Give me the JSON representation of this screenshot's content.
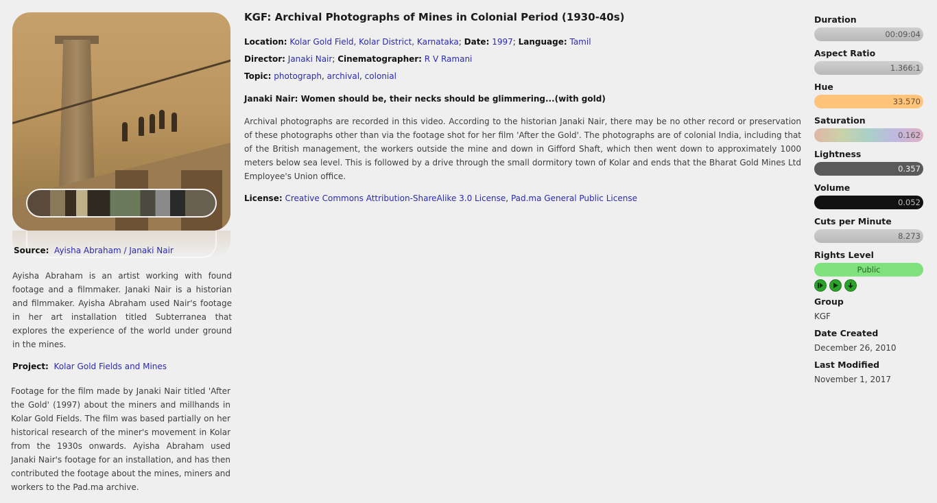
{
  "title": "KGF: Archival Photographs of Mines in Colonial Period (1930-40s)",
  "meta": {
    "location_label": "Location:",
    "location": "Kolar Gold Field, Kolar District, Karnataka",
    "date_label": "Date:",
    "date": "1997",
    "language_label": "Language:",
    "language": "Tamil",
    "director_label": "Director:",
    "director": "Janaki Nair",
    "cinematographer_label": "Cinematographer:",
    "cinematographer": "R V Ramani",
    "topic_label": "Topic:",
    "topics": [
      "photograph",
      "archival",
      "colonial"
    ]
  },
  "quote": "Janaki Nair: Women should be, their necks should be glimmering...(with gold)",
  "description": "Archival photographs are recorded in this video. According to the historian Janaki Nair, there may be no other record or preservation of these photographs other than via the footage shot for her film 'After the Gold'. The photographs are of colonial India, including that of the British management, the workers outside the mine and down in Gifford Shaft, which then went down to approximately 1000 meters below sea level. This is followed by a drive through the small dormitory town of Kolar and ends that the Bharat Gold Mines Ltd Employee's Union office.",
  "license": {
    "label": "License:",
    "items": [
      "Creative Commons Attribution-ShareAlike 3.0 License",
      "Pad.ma General Public License"
    ]
  },
  "source": {
    "label": "Source:",
    "value": "Ayisha Abraham / Janaki Nair",
    "description": "Ayisha Abraham is an artist working with found footage and a filmmaker. Janaki Nair is a historian and filmmaker. Ayisha Abraham used Nair's footage in her art installation titled Subterranea that explores the experience of the world under ground in the mines."
  },
  "project": {
    "label": "Project:",
    "value": "Kolar Gold Fields and Mines",
    "description": "Footage for the film made by Janaki Nair titled 'After the Gold' (1997) about the miners and millhands in Kolar Gold Fields. The film was based partially on her historical research of the miner's movement in Kolar from the 1930s onwards. Ayisha Abraham used Janaki Nair's footage for an installation, and has then contributed the footage about the mines, miners and workers to the Pad.ma archive."
  },
  "stats": {
    "duration_label": "Duration",
    "duration": "00:09:04",
    "aspect_label": "Aspect Ratio",
    "aspect": "1.366:1",
    "hue_label": "Hue",
    "hue": "33.570",
    "saturation_label": "Saturation",
    "saturation": "0.162",
    "lightness_label": "Lightness",
    "lightness": "0.357",
    "volume_label": "Volume",
    "volume": "0.052",
    "cuts_label": "Cuts per Minute",
    "cuts": "8.273",
    "rights_label": "Rights Level",
    "rights": "Public",
    "rights_color": "#7fe27c",
    "hue_color": "#ffc37a",
    "group_label": "Group",
    "group": "KGF",
    "created_label": "Date Created",
    "created": "December 26, 2010",
    "modified_label": "Last Modified",
    "modified": "November 1, 2017"
  },
  "icons": [
    "play-in-out-icon",
    "play-icon",
    "download-icon"
  ]
}
